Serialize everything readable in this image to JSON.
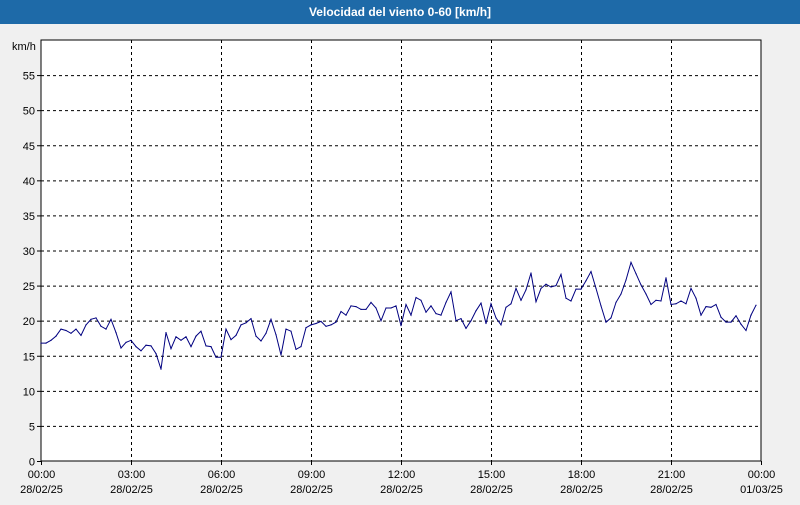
{
  "window": {
    "title": "Velocidad del viento 0-60 [km/h]"
  },
  "colors": {
    "title_bg": "#1e6aa8",
    "plot_bg": "#ffffff",
    "page_bg": "#f0f0f0",
    "series_line": "#000080",
    "grid": "#000000"
  },
  "chart_data": {
    "type": "line",
    "title": "Velocidad del viento 0-60 [km/h]",
    "ylabel": "km/h",
    "xlabel": "",
    "ylim": [
      0,
      60
    ],
    "y_ticks": [
      0,
      5,
      10,
      15,
      20,
      25,
      30,
      35,
      40,
      45,
      50,
      55
    ],
    "xlim": [
      "28/02/25 00:00",
      "01/03/25 00:00"
    ],
    "x_ticks": [
      {
        "time": "00:00",
        "date": "28/02/25"
      },
      {
        "time": "03:00",
        "date": "28/02/25"
      },
      {
        "time": "06:00",
        "date": "28/02/25"
      },
      {
        "time": "09:00",
        "date": "28/02/25"
      },
      {
        "time": "12:00",
        "date": "28/02/25"
      },
      {
        "time": "15:00",
        "date": "28/02/25"
      },
      {
        "time": "18:00",
        "date": "28/02/25"
      },
      {
        "time": "21:00",
        "date": "28/02/25"
      },
      {
        "time": "00:00",
        "date": "01/03/25"
      }
    ],
    "grid": true,
    "grid_style": "dashed",
    "series": [
      {
        "points": [
          [
            "00:00",
            16.8
          ],
          [
            "00:10",
            16.8
          ],
          [
            "00:20",
            17.2
          ],
          [
            "00:30",
            17.8
          ],
          [
            "00:40",
            18.8
          ],
          [
            "00:50",
            18.6
          ],
          [
            "01:00",
            18.2
          ],
          [
            "01:10",
            18.8
          ],
          [
            "01:20",
            17.9
          ],
          [
            "01:30",
            19.4
          ],
          [
            "01:40",
            20.2
          ],
          [
            "01:50",
            20.4
          ],
          [
            "02:00",
            19.2
          ],
          [
            "02:10",
            18.8
          ],
          [
            "02:20",
            20.2
          ],
          [
            "02:30",
            18.3
          ],
          [
            "02:40",
            16.1
          ],
          [
            "02:50",
            16.9
          ],
          [
            "03:00",
            17.2
          ],
          [
            "03:10",
            16.3
          ],
          [
            "03:20",
            15.7
          ],
          [
            "03:30",
            16.5
          ],
          [
            "03:40",
            16.4
          ],
          [
            "03:50",
            15.3
          ],
          [
            "04:00",
            13.1
          ],
          [
            "04:10",
            18.3
          ],
          [
            "04:20",
            16.0
          ],
          [
            "04:30",
            17.7
          ],
          [
            "04:40",
            17.2
          ],
          [
            "04:50",
            17.7
          ],
          [
            "05:00",
            16.3
          ],
          [
            "05:10",
            17.8
          ],
          [
            "05:20",
            18.5
          ],
          [
            "05:30",
            16.4
          ],
          [
            "05:40",
            16.3
          ],
          [
            "05:50",
            14.8
          ],
          [
            "06:00",
            14.8
          ],
          [
            "06:10",
            18.8
          ],
          [
            "06:20",
            17.3
          ],
          [
            "06:30",
            17.9
          ],
          [
            "06:40",
            19.4
          ],
          [
            "06:50",
            19.7
          ],
          [
            "07:00",
            20.3
          ],
          [
            "07:10",
            17.8
          ],
          [
            "07:20",
            17.1
          ],
          [
            "07:30",
            18.2
          ],
          [
            "07:40",
            20.2
          ],
          [
            "07:50",
            18.0
          ],
          [
            "08:00",
            15.1
          ],
          [
            "08:10",
            18.8
          ],
          [
            "08:20",
            18.5
          ],
          [
            "08:30",
            15.9
          ],
          [
            "08:40",
            16.3
          ],
          [
            "08:50",
            19.0
          ],
          [
            "09:00",
            19.4
          ],
          [
            "09:10",
            19.6
          ],
          [
            "09:20",
            19.9
          ],
          [
            "09:30",
            19.2
          ],
          [
            "09:40",
            19.4
          ],
          [
            "09:50",
            19.8
          ],
          [
            "10:00",
            21.3
          ],
          [
            "10:10",
            20.8
          ],
          [
            "10:20",
            22.1
          ],
          [
            "10:30",
            22.0
          ],
          [
            "10:40",
            21.6
          ],
          [
            "10:50",
            21.6
          ],
          [
            "11:00",
            22.6
          ],
          [
            "11:10",
            21.8
          ],
          [
            "11:20",
            20.0
          ],
          [
            "11:30",
            21.8
          ],
          [
            "11:40",
            21.8
          ],
          [
            "11:50",
            22.1
          ],
          [
            "12:00",
            19.3
          ],
          [
            "12:10",
            22.3
          ],
          [
            "12:20",
            20.8
          ],
          [
            "12:30",
            23.3
          ],
          [
            "12:40",
            22.9
          ],
          [
            "12:50",
            21.2
          ],
          [
            "13:00",
            22.1
          ],
          [
            "13:10",
            21.0
          ],
          [
            "13:20",
            20.8
          ],
          [
            "13:30",
            22.6
          ],
          [
            "13:40",
            24.1
          ],
          [
            "13:50",
            20.0
          ],
          [
            "14:00",
            20.3
          ],
          [
            "14:10",
            18.9
          ],
          [
            "14:20",
            20.0
          ],
          [
            "14:30",
            21.4
          ],
          [
            "14:40",
            22.5
          ],
          [
            "14:50",
            19.6
          ],
          [
            "15:00",
            22.4
          ],
          [
            "15:10",
            20.4
          ],
          [
            "15:20",
            19.4
          ],
          [
            "15:30",
            21.9
          ],
          [
            "15:40",
            22.4
          ],
          [
            "15:50",
            24.6
          ],
          [
            "16:00",
            22.9
          ],
          [
            "16:10",
            24.4
          ],
          [
            "16:20",
            26.8
          ],
          [
            "16:30",
            22.7
          ],
          [
            "16:40",
            24.6
          ],
          [
            "16:50",
            25.2
          ],
          [
            "17:00",
            24.8
          ],
          [
            "17:10",
            25.0
          ],
          [
            "17:20",
            26.6
          ],
          [
            "17:30",
            23.2
          ],
          [
            "17:40",
            22.8
          ],
          [
            "17:50",
            24.5
          ],
          [
            "18:00",
            24.5
          ],
          [
            "18:10",
            25.7
          ],
          [
            "18:20",
            27.0
          ],
          [
            "18:30",
            24.6
          ],
          [
            "18:40",
            22.1
          ],
          [
            "18:50",
            19.8
          ],
          [
            "19:00",
            20.4
          ],
          [
            "19:10",
            22.6
          ],
          [
            "19:20",
            23.8
          ],
          [
            "19:30",
            25.8
          ],
          [
            "19:40",
            28.3
          ],
          [
            "19:50",
            26.7
          ],
          [
            "20:00",
            25.1
          ],
          [
            "20:10",
            23.8
          ],
          [
            "20:20",
            22.3
          ],
          [
            "20:30",
            22.9
          ],
          [
            "20:40",
            22.8
          ],
          [
            "20:50",
            26.1
          ],
          [
            "21:00",
            22.3
          ],
          [
            "21:10",
            22.4
          ],
          [
            "21:20",
            22.8
          ],
          [
            "21:30",
            22.4
          ],
          [
            "21:40",
            24.6
          ],
          [
            "21:50",
            23.2
          ],
          [
            "22:00",
            20.8
          ],
          [
            "22:10",
            22.0
          ],
          [
            "22:20",
            21.9
          ],
          [
            "22:30",
            22.3
          ],
          [
            "22:40",
            20.5
          ],
          [
            "22:50",
            19.8
          ],
          [
            "23:00",
            19.8
          ],
          [
            "23:10",
            20.7
          ],
          [
            "23:20",
            19.5
          ],
          [
            "23:30",
            18.6
          ],
          [
            "23:40",
            20.8
          ],
          [
            "23:50",
            22.2
          ]
        ]
      }
    ]
  }
}
